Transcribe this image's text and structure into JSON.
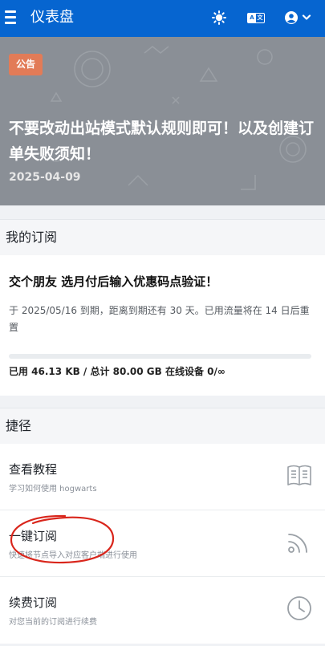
{
  "header": {
    "title": "仪表盘",
    "icons": [
      "menu-icon",
      "sun-icon",
      "language-icon",
      "user-icon",
      "chevron-down-icon"
    ]
  },
  "announcement": {
    "badge": "公告",
    "title": "不要改动出站模式默认规则即可！以及创建订单失败须知！",
    "date": "2025-04-09"
  },
  "subscription": {
    "section_title": "我的订阅",
    "plan_name": "交个朋友 选月付后输入优惠码点验证！",
    "expiry_text": "于 2025/05/16 到期，距离到期还有 30 天。已用流量将在 14 日后重置",
    "usage_fraction": 0.0,
    "usage_text": "已用 46.13 KB / 总计 80.00 GB 在线设备 0/∞"
  },
  "shortcuts": {
    "section_title": "捷径",
    "items": [
      {
        "title": "查看教程",
        "subtitle": "学习如何使用 hogwarts",
        "icon": "book-icon"
      },
      {
        "title": "一键订阅",
        "subtitle": "快速将节点导入对应客户端进行使用",
        "icon": "rss-icon"
      },
      {
        "title": "续费订阅",
        "subtitle": "对您当前的订阅进行续费",
        "icon": "clock-icon"
      }
    ]
  },
  "colors": {
    "primary": "#0665d0",
    "badge": "#e27b57",
    "annotation": "#d9261c"
  }
}
